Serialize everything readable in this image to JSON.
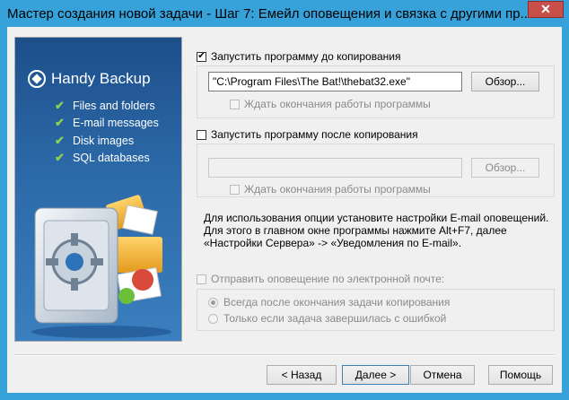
{
  "window": {
    "title": "Мастер создания новой задачи - Шаг 7: Емейл оповещения и связка с другими пр...",
    "close_label": "✕"
  },
  "banner": {
    "logo_text": "Handy Backup",
    "features": [
      "Files and folders",
      "E-mail messages",
      "Disk images",
      "SQL databases"
    ]
  },
  "pre_copy": {
    "run_label": "Запустить программу до копирования",
    "run_checked": true,
    "path_value": "\"C:\\Program Files\\The Bat!\\thebat32.exe\"",
    "browse_label": "Обзор...",
    "wait_label": "Ждать окончания работы программы",
    "wait_checked": false
  },
  "post_copy": {
    "run_label": "Запустить программу после копирования",
    "run_checked": false,
    "path_value": "",
    "browse_label": "Обзор...",
    "wait_label": "Ждать окончания работы программы",
    "wait_checked": false
  },
  "info_text": "Для использования опции установите настройки E-mail оповещений. Для этого в главном окне программы нажмите Alt+F7, далее «Настройки Сервера» -> «Уведомления по E-mail».",
  "email": {
    "send_label": "Отправить оповещение по электронной почте:",
    "send_checked": false,
    "options": [
      {
        "label": "Всегда после окончания задачи копирования",
        "selected": true
      },
      {
        "label": "Только если задача завершилась с ошибкой",
        "selected": false
      }
    ]
  },
  "buttons": {
    "back": "< Назад",
    "next": "Далее >",
    "cancel": "Отмена",
    "help": "Помощь"
  },
  "colors": {
    "frame": "#36a2d9",
    "close": "#c7504b",
    "banner": "#2b67a6",
    "feature_check": "#8fd14f"
  }
}
